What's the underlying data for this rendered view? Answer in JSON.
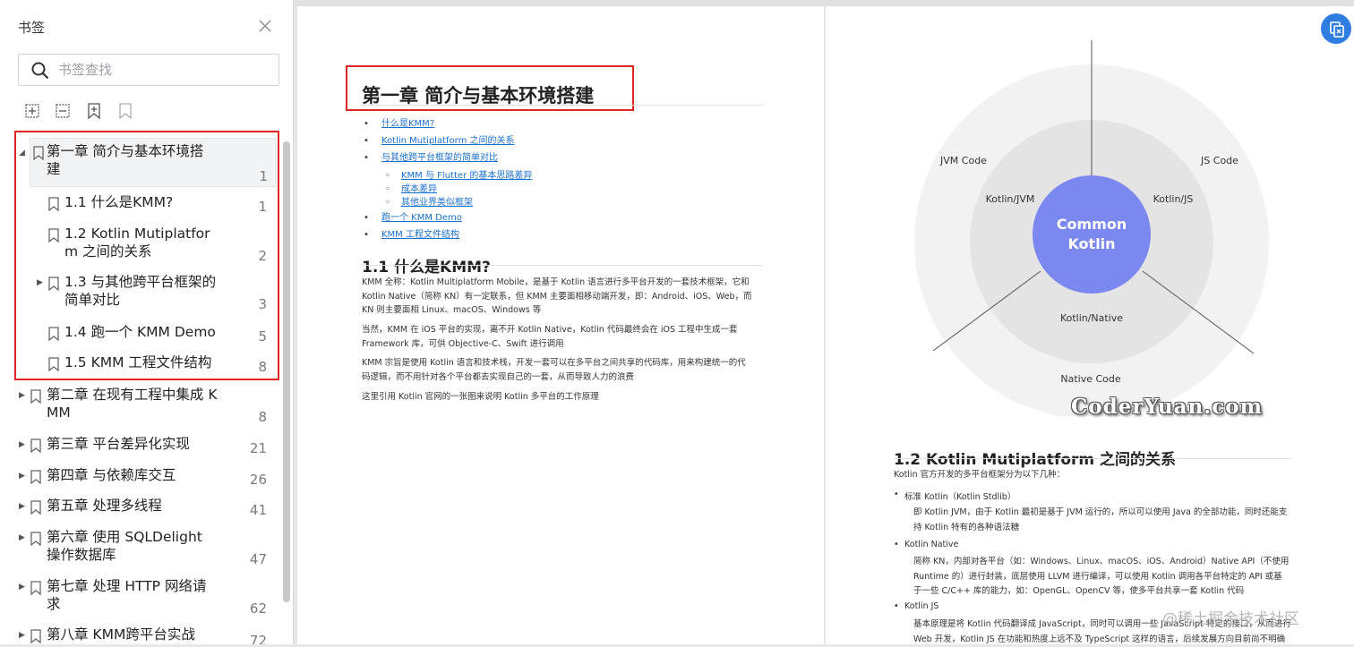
{
  "sidebar": {
    "title": "书签",
    "search_placeholder": "书签查找",
    "tree": [
      {
        "label_lines": [
          "第一章 简介与基本环境搭",
          "建"
        ],
        "page": "1"
      },
      {
        "label_lines": [
          "1.1 什么是KMM?"
        ],
        "page": "1"
      },
      {
        "label_lines": [
          "1.2 Kotlin Mutiplatfor",
          "m 之间的关系"
        ],
        "page": "2"
      },
      {
        "label_lines": [
          "1.3 与其他跨平台框架的",
          "简单对比"
        ],
        "page": "3"
      },
      {
        "label_lines": [
          "1.4 跑一个 KMM Demo"
        ],
        "page": "5"
      },
      {
        "label_lines": [
          "1.5 KMM 工程文件结构"
        ],
        "page": "8"
      },
      {
        "label_lines": [
          "第二章 在现有工程中集成 K",
          "MM"
        ],
        "page": "8"
      },
      {
        "label_lines": [
          "第三章 平台差异化实现"
        ],
        "page": "21"
      },
      {
        "label_lines": [
          "第四章 与依赖库交互"
        ],
        "page": "26"
      },
      {
        "label_lines": [
          "第五章 处理多线程"
        ],
        "page": "41"
      },
      {
        "label_lines": [
          "第六章 使用 SQLDelight",
          "操作数据库"
        ],
        "page": "47"
      },
      {
        "label_lines": [
          "第七章 处理 HTTP 网络请",
          "求"
        ],
        "page": "62"
      },
      {
        "label_lines": [
          "第八章 KMM跨平台实战"
        ],
        "page": "72"
      }
    ]
  },
  "page1": {
    "heading": "第一章 简介与基本环境搭建",
    "toc": [
      "什么是KMM?",
      "Kotlin Mutiplatform 之间的关系",
      "与其他跨平台框架的简单对比"
    ],
    "toc_sub": [
      "KMM 与 Flutter 的基本思路差异",
      "成本差异",
      "其他业界类似框架"
    ],
    "toc_after": [
      "跑一个 KMM Demo",
      "KMM 工程文件结构"
    ],
    "section_heading": "1.1 什么是KMM?",
    "para1": [
      "KMM 全称：Kotlin Multiplatform Mobile，是基于 Kotlin 语言进行多平台开发的一套技术框架，它和",
      "Kotlin Native（简称 KN）有一定联系，但 KMM 主要面相移动端开发，即：Android、iOS、Web，而",
      "KN 则主要面相 Linux、macOS、Windows 等"
    ],
    "para2": [
      "当然，KMM 在 iOS 平台的实现，离不开 Kotlin Native，Kotlin 代码最终会在 iOS 工程中生成一套",
      "Framework 库，可供 Objective-C、Swift 进行调用"
    ],
    "para3": [
      "KMM 宗旨是使用 Kotlin 语言和技术栈，开发一套可以在多平台之间共享的代码库，用来构建统一的代",
      "码逻辑，而不用针对各个平台都去实现自己的一套，从而导致人力的浪费"
    ],
    "para4": "这里引用 Kotlin 官网的一张图来说明 Kotlin 多平台的工作原理"
  },
  "page2": {
    "diagram": {
      "center": [
        "Common",
        "Kotlin"
      ],
      "inner": [
        "Kotlin/JVM",
        "Kotlin/JS",
        "Kotlin/Native"
      ],
      "outer": [
        "JVM Code",
        "JS Code",
        "Native Code"
      ]
    },
    "watermark": "CoderYuan.com",
    "section_heading": "1.2 Kotlin Mutiplatform 之间的关系",
    "intro": "Kotlin 官方开发的多平台框架分为以下几种：",
    "b1": "标准 Kotlin（Kotlin Stdlib）",
    "b1_text": [
      "即 Kotlin JVM，由于 Kotlin 最初是基于 JVM 运行的，所以可以使用 Java 的全部功能，同时还能支",
      "持 Kotlin 特有的各种语法糖"
    ],
    "b2": "Kotlin Native",
    "b2_text": [
      "简称 KN，内部对各平台（如：Windows、Linux、macOS、iOS、Android）Native API（不使用",
      "Runtime 的）进行封装，底层使用 LLVM 进行编译，可以使用 Kotlin 调用各平台特定的 API 或基",
      "于一些 C/C++ 库的能力，如：OpenGL、OpenCV 等，使多平台共享一套 Kotlin 代码"
    ],
    "b3": "Kotlin JS",
    "b3_text": [
      "基本原理是将 Kotlin 代码翻译成 JavaScript，同时可以调用一些 JavaScript 特定的接口，从而进行",
      "Web 开发，Kotlin JS 在功能和热度上远不及 TypeScript 这样的语言，后续发展方向目前尚不明确"
    ]
  },
  "footer_watermark": "@稀土掘金技术社区"
}
